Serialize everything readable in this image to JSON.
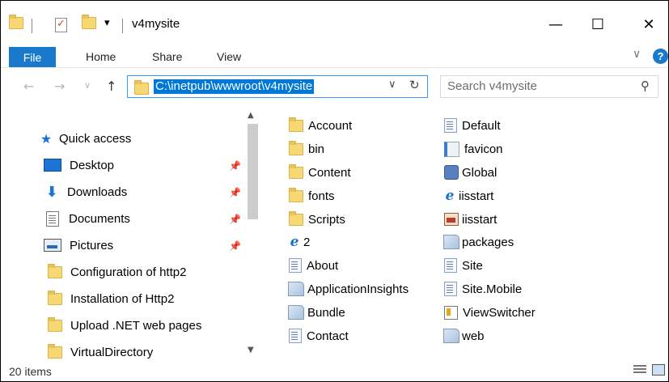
{
  "window": {
    "title": "v4mysite",
    "minimize_glyph": "—",
    "maximize_glyph": "☐",
    "close_glyph": "✕"
  },
  "ribbon": {
    "tabs": [
      "File",
      "Home",
      "Share",
      "View"
    ],
    "help": "?",
    "collapse_glyph": "∨"
  },
  "address": {
    "path": "C:\\inetpub\\wwwroot\\v4mysite",
    "back_glyph": "←",
    "forward_glyph": "→",
    "recent_glyph": "∨",
    "up_glyph": "↑",
    "dropdown_glyph": "∨",
    "refresh_glyph": "↻"
  },
  "search": {
    "placeholder": "Search v4mysite",
    "icon_glyph": "⚲"
  },
  "nav_pane": {
    "items": [
      {
        "label": "Quick access",
        "icon": "star-icon",
        "pinned": false
      },
      {
        "label": "Desktop",
        "icon": "desktop-icon",
        "pinned": true
      },
      {
        "label": "Downloads",
        "icon": "download-icon",
        "pinned": true
      },
      {
        "label": "Documents",
        "icon": "documents-icon",
        "pinned": true
      },
      {
        "label": "Pictures",
        "icon": "pictures-icon",
        "pinned": true
      },
      {
        "label": "Configuration of http2",
        "icon": "folder-icon",
        "pinned": false
      },
      {
        "label": "Installation of Http2",
        "icon": "folder-icon",
        "pinned": false
      },
      {
        "label": "Upload .NET web pages",
        "icon": "folder-icon",
        "pinned": false
      },
      {
        "label": "VirtualDirectory",
        "icon": "folder-icon",
        "pinned": false
      }
    ],
    "pin_glyph": "📌"
  },
  "files": {
    "column1": [
      {
        "name": "Account",
        "icon": "folder-icon"
      },
      {
        "name": "bin",
        "icon": "folder-icon"
      },
      {
        "name": "Content",
        "icon": "folder-icon"
      },
      {
        "name": "fonts",
        "icon": "folder-icon"
      },
      {
        "name": "Scripts",
        "icon": "folder-icon"
      },
      {
        "name": "2",
        "icon": "ie-icon"
      },
      {
        "name": "About",
        "icon": "page-icon"
      },
      {
        "name": "ApplicationInsights",
        "icon": "generic-file-icon"
      },
      {
        "name": "Bundle",
        "icon": "generic-file-icon"
      },
      {
        "name": "Contact",
        "icon": "page-icon"
      }
    ],
    "column2": [
      {
        "name": "Default",
        "icon": "page-icon"
      },
      {
        "name": "favicon",
        "icon": "favicon-file-icon"
      },
      {
        "name": "Global",
        "icon": "global-asax-icon"
      },
      {
        "name": "iisstart",
        "icon": "ie-icon"
      },
      {
        "name": "iisstart",
        "icon": "image-file-icon"
      },
      {
        "name": "packages",
        "icon": "generic-file-icon"
      },
      {
        "name": "Site",
        "icon": "page-icon"
      },
      {
        "name": "Site.Mobile",
        "icon": "page-icon"
      },
      {
        "name": "ViewSwitcher",
        "icon": "viewswitcher-icon"
      },
      {
        "name": "web",
        "icon": "generic-file-icon"
      }
    ]
  },
  "status_bar": {
    "item_count": "20 items"
  },
  "colors": {
    "accent": "#1979ca",
    "selection": "#0078d7",
    "folder": "#f8d775"
  }
}
